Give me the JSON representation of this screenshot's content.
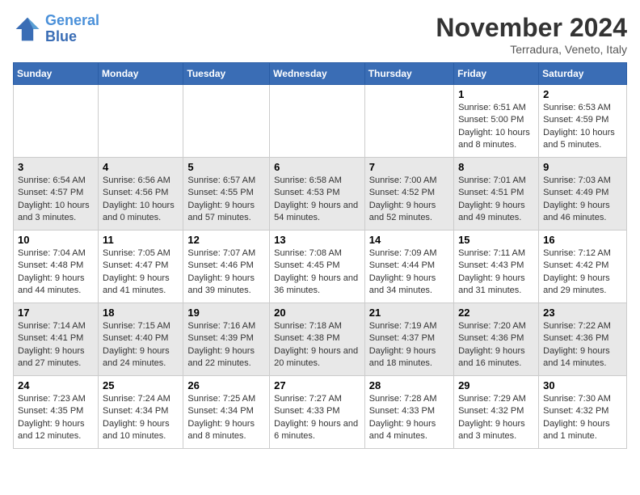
{
  "logo": {
    "line1": "General",
    "line2": "Blue"
  },
  "title": "November 2024",
  "subtitle": "Terradura, Veneto, Italy",
  "days_of_week": [
    "Sunday",
    "Monday",
    "Tuesday",
    "Wednesday",
    "Thursday",
    "Friday",
    "Saturday"
  ],
  "weeks": [
    [
      {
        "day": "",
        "info": ""
      },
      {
        "day": "",
        "info": ""
      },
      {
        "day": "",
        "info": ""
      },
      {
        "day": "",
        "info": ""
      },
      {
        "day": "",
        "info": ""
      },
      {
        "day": "1",
        "info": "Sunrise: 6:51 AM\nSunset: 5:00 PM\nDaylight: 10 hours and 8 minutes."
      },
      {
        "day": "2",
        "info": "Sunrise: 6:53 AM\nSunset: 4:59 PM\nDaylight: 10 hours and 5 minutes."
      }
    ],
    [
      {
        "day": "3",
        "info": "Sunrise: 6:54 AM\nSunset: 4:57 PM\nDaylight: 10 hours and 3 minutes."
      },
      {
        "day": "4",
        "info": "Sunrise: 6:56 AM\nSunset: 4:56 PM\nDaylight: 10 hours and 0 minutes."
      },
      {
        "day": "5",
        "info": "Sunrise: 6:57 AM\nSunset: 4:55 PM\nDaylight: 9 hours and 57 minutes."
      },
      {
        "day": "6",
        "info": "Sunrise: 6:58 AM\nSunset: 4:53 PM\nDaylight: 9 hours and 54 minutes."
      },
      {
        "day": "7",
        "info": "Sunrise: 7:00 AM\nSunset: 4:52 PM\nDaylight: 9 hours and 52 minutes."
      },
      {
        "day": "8",
        "info": "Sunrise: 7:01 AM\nSunset: 4:51 PM\nDaylight: 9 hours and 49 minutes."
      },
      {
        "day": "9",
        "info": "Sunrise: 7:03 AM\nSunset: 4:49 PM\nDaylight: 9 hours and 46 minutes."
      }
    ],
    [
      {
        "day": "10",
        "info": "Sunrise: 7:04 AM\nSunset: 4:48 PM\nDaylight: 9 hours and 44 minutes."
      },
      {
        "day": "11",
        "info": "Sunrise: 7:05 AM\nSunset: 4:47 PM\nDaylight: 9 hours and 41 minutes."
      },
      {
        "day": "12",
        "info": "Sunrise: 7:07 AM\nSunset: 4:46 PM\nDaylight: 9 hours and 39 minutes."
      },
      {
        "day": "13",
        "info": "Sunrise: 7:08 AM\nSunset: 4:45 PM\nDaylight: 9 hours and 36 minutes."
      },
      {
        "day": "14",
        "info": "Sunrise: 7:09 AM\nSunset: 4:44 PM\nDaylight: 9 hours and 34 minutes."
      },
      {
        "day": "15",
        "info": "Sunrise: 7:11 AM\nSunset: 4:43 PM\nDaylight: 9 hours and 31 minutes."
      },
      {
        "day": "16",
        "info": "Sunrise: 7:12 AM\nSunset: 4:42 PM\nDaylight: 9 hours and 29 minutes."
      }
    ],
    [
      {
        "day": "17",
        "info": "Sunrise: 7:14 AM\nSunset: 4:41 PM\nDaylight: 9 hours and 27 minutes."
      },
      {
        "day": "18",
        "info": "Sunrise: 7:15 AM\nSunset: 4:40 PM\nDaylight: 9 hours and 24 minutes."
      },
      {
        "day": "19",
        "info": "Sunrise: 7:16 AM\nSunset: 4:39 PM\nDaylight: 9 hours and 22 minutes."
      },
      {
        "day": "20",
        "info": "Sunrise: 7:18 AM\nSunset: 4:38 PM\nDaylight: 9 hours and 20 minutes."
      },
      {
        "day": "21",
        "info": "Sunrise: 7:19 AM\nSunset: 4:37 PM\nDaylight: 9 hours and 18 minutes."
      },
      {
        "day": "22",
        "info": "Sunrise: 7:20 AM\nSunset: 4:36 PM\nDaylight: 9 hours and 16 minutes."
      },
      {
        "day": "23",
        "info": "Sunrise: 7:22 AM\nSunset: 4:36 PM\nDaylight: 9 hours and 14 minutes."
      }
    ],
    [
      {
        "day": "24",
        "info": "Sunrise: 7:23 AM\nSunset: 4:35 PM\nDaylight: 9 hours and 12 minutes."
      },
      {
        "day": "25",
        "info": "Sunrise: 7:24 AM\nSunset: 4:34 PM\nDaylight: 9 hours and 10 minutes."
      },
      {
        "day": "26",
        "info": "Sunrise: 7:25 AM\nSunset: 4:34 PM\nDaylight: 9 hours and 8 minutes."
      },
      {
        "day": "27",
        "info": "Sunrise: 7:27 AM\nSunset: 4:33 PM\nDaylight: 9 hours and 6 minutes."
      },
      {
        "day": "28",
        "info": "Sunrise: 7:28 AM\nSunset: 4:33 PM\nDaylight: 9 hours and 4 minutes."
      },
      {
        "day": "29",
        "info": "Sunrise: 7:29 AM\nSunset: 4:32 PM\nDaylight: 9 hours and 3 minutes."
      },
      {
        "day": "30",
        "info": "Sunrise: 7:30 AM\nSunset: 4:32 PM\nDaylight: 9 hours and 1 minute."
      }
    ]
  ]
}
